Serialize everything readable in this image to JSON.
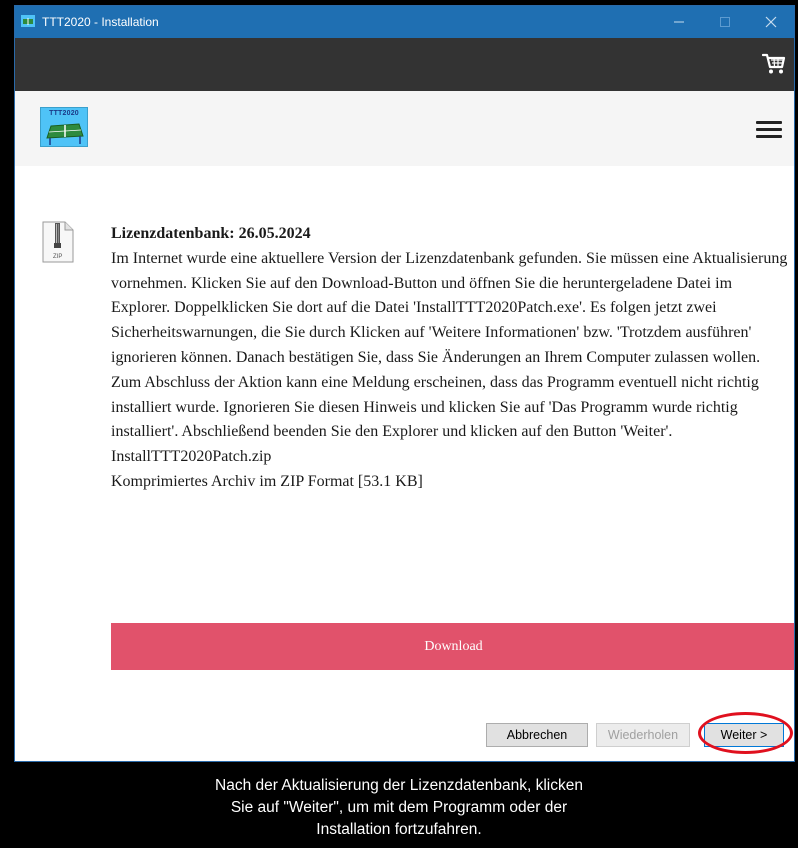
{
  "window": {
    "title": "TTT2020 - Installation"
  },
  "topbar": {
    "cart_icon": "shopping-cart-icon"
  },
  "navbar": {
    "logo_text": "TTT2020",
    "menu_icon": "hamburger-menu-icon"
  },
  "content": {
    "file_icon": "zip-file-icon",
    "heading": "Lizenzdatenbank: 26.05.2024",
    "body": "Im Internet wurde eine aktuellere Version der Lizenzdatenbank gefunden. Sie müssen eine Aktualisierung vornehmen. Klicken Sie auf den Download-Button und öffnen Sie die heruntergeladene Datei im Explorer. Doppelklicken Sie dort auf die Datei 'InstallTTT2020Patch.exe'. Es folgen jetzt zwei Sicherheitswarnungen, die Sie durch Klicken auf 'Weitere Informationen' bzw. 'Trotzdem ausführen' ignorieren können. Danach bestätigen Sie, dass Sie Änderungen an Ihrem Computer zulassen wollen. Zum Abschluss der Aktion kann eine Meldung erscheinen, dass das Programm eventuell nicht richtig installiert wurde. Ignorieren Sie diesen Hinweis und klicken Sie auf 'Das Programm wurde richtig installiert'. Abschließend beenden Sie den Explorer und klicken auf den Button 'Weiter'.",
    "filename": "InstallTTT2020Patch.zip",
    "fileinfo": "Komprimiertes Archiv im ZIP Format [53.1 KB]",
    "download_label": "Download"
  },
  "footer": {
    "cancel_label": "Abbrechen",
    "retry_label": "Wiederholen",
    "next_label": "Weiter >"
  },
  "caption": {
    "line1": "Nach der Aktualisierung der Lizenzdatenbank, klicken",
    "line2": "Sie auf \"Weiter\", um mit dem Programm oder der",
    "line3": "Installation fortzufahren."
  },
  "colors": {
    "titlebar": "#1f6fb2",
    "topbar": "#333333",
    "navbar": "#f5f5f5",
    "download_button": "#e1526b",
    "highlight_circle": "#e0101e"
  }
}
